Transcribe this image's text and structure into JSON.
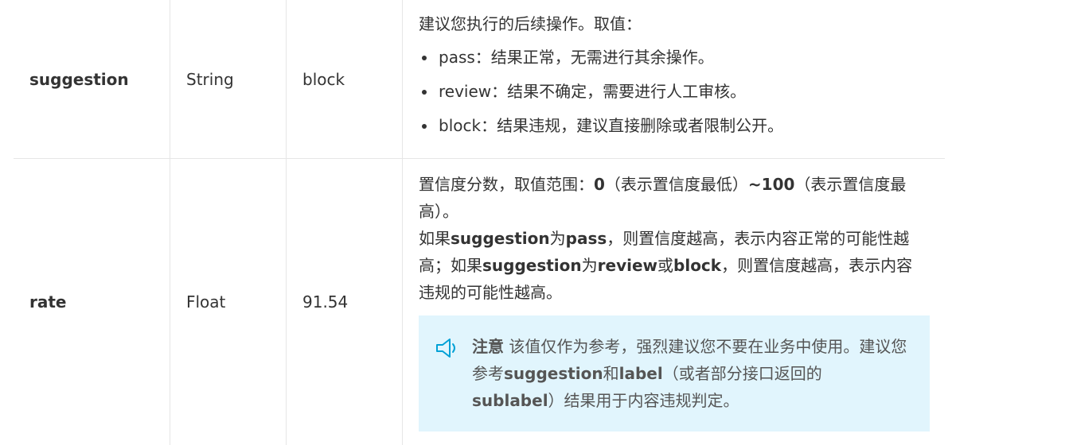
{
  "rows": [
    {
      "name": "suggestion",
      "type": "String",
      "example": "block",
      "intro": "建议您执行的后续操作。取值：",
      "options": [
        {
          "key": "pass",
          "text": "：结果正常，无需进行其余操作。"
        },
        {
          "key": "review",
          "text": "：结果不确定，需要进行人工审核。"
        },
        {
          "key": "block",
          "text": "：结果违规，建议直接删除或者限制公开。"
        }
      ]
    },
    {
      "name": "rate",
      "type": "Float",
      "example": "91.54",
      "p1": {
        "a": "置信度分数，取值范围：",
        "b1": "0",
        "c": "（表示置信度最低）",
        "b2": "~100",
        "d": "（表示置信度最高）。"
      },
      "p2": {
        "a": "如果",
        "b1": "suggestion",
        "c": "为",
        "b2": "pass",
        "d": "，则置信度越高，表示内容正常的可能性越高；如果",
        "b3": "suggestion",
        "e": "为",
        "b4": "review",
        "f": "或",
        "b5": "block",
        "g": "，则置信度越高，表示内容违规的可能性越高。"
      },
      "note": {
        "title": "注意",
        "a": " 该值仅作为参考，强烈建议您不要在业务中使用。建议您参考",
        "b1": "suggestion",
        "c": "和",
        "b2": "label",
        "d": "（或者部分接口返回的",
        "b3": "sublabel",
        "e": "）结果用于内容违规判定。",
        "icon": "speaker-icon",
        "icon_color": "#00a1d6",
        "bg": "#e1f5fd"
      }
    }
  ]
}
